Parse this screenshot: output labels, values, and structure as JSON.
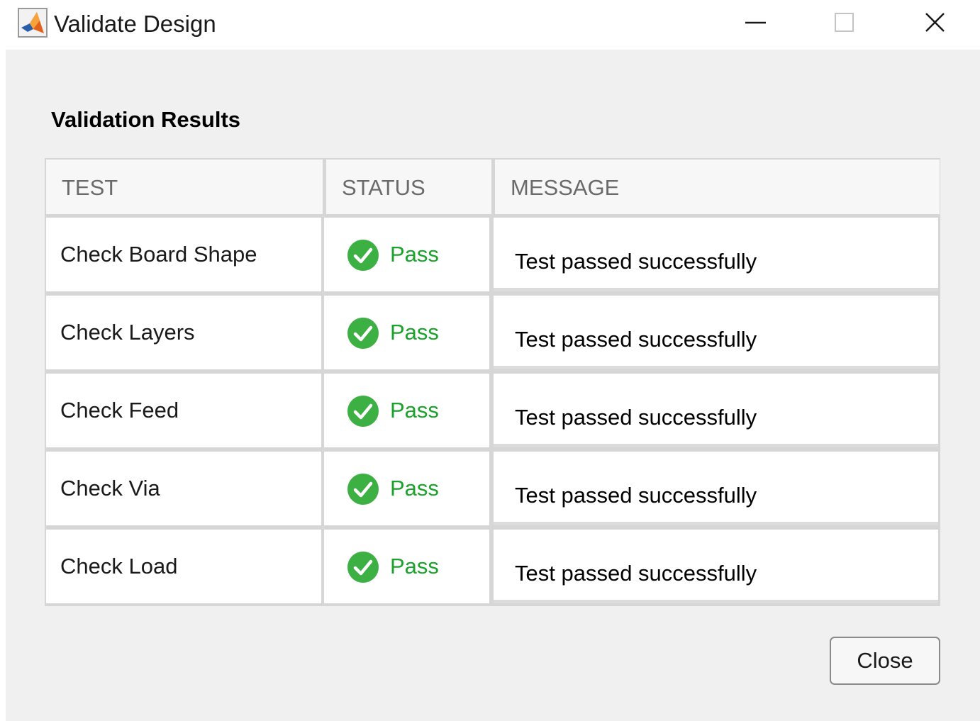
{
  "window": {
    "title": "Validate Design",
    "app_icon": "matlab-icon",
    "controls": [
      "minimize-icon",
      "maximize-icon",
      "close-icon"
    ]
  },
  "section_title": "Validation Results",
  "table": {
    "headers": [
      "TEST",
      "STATUS",
      "MESSAGE"
    ],
    "rows": [
      {
        "test": "Check Board Shape",
        "status": "Pass",
        "message": "Test passed successfully"
      },
      {
        "test": "Check Layers",
        "status": "Pass",
        "message": "Test passed successfully"
      },
      {
        "test": "Check Feed",
        "status": "Pass",
        "message": "Test passed successfully"
      },
      {
        "test": "Check Via",
        "status": "Pass",
        "message": "Test passed successfully"
      },
      {
        "test": "Check Load",
        "status": "Pass",
        "message": "Test passed successfully"
      }
    ]
  },
  "buttons": {
    "close_label": "Close"
  },
  "colors": {
    "pass": "#1aa32a",
    "pass_icon": "#3cb043",
    "dialog_bg": "#f0f0f0"
  }
}
